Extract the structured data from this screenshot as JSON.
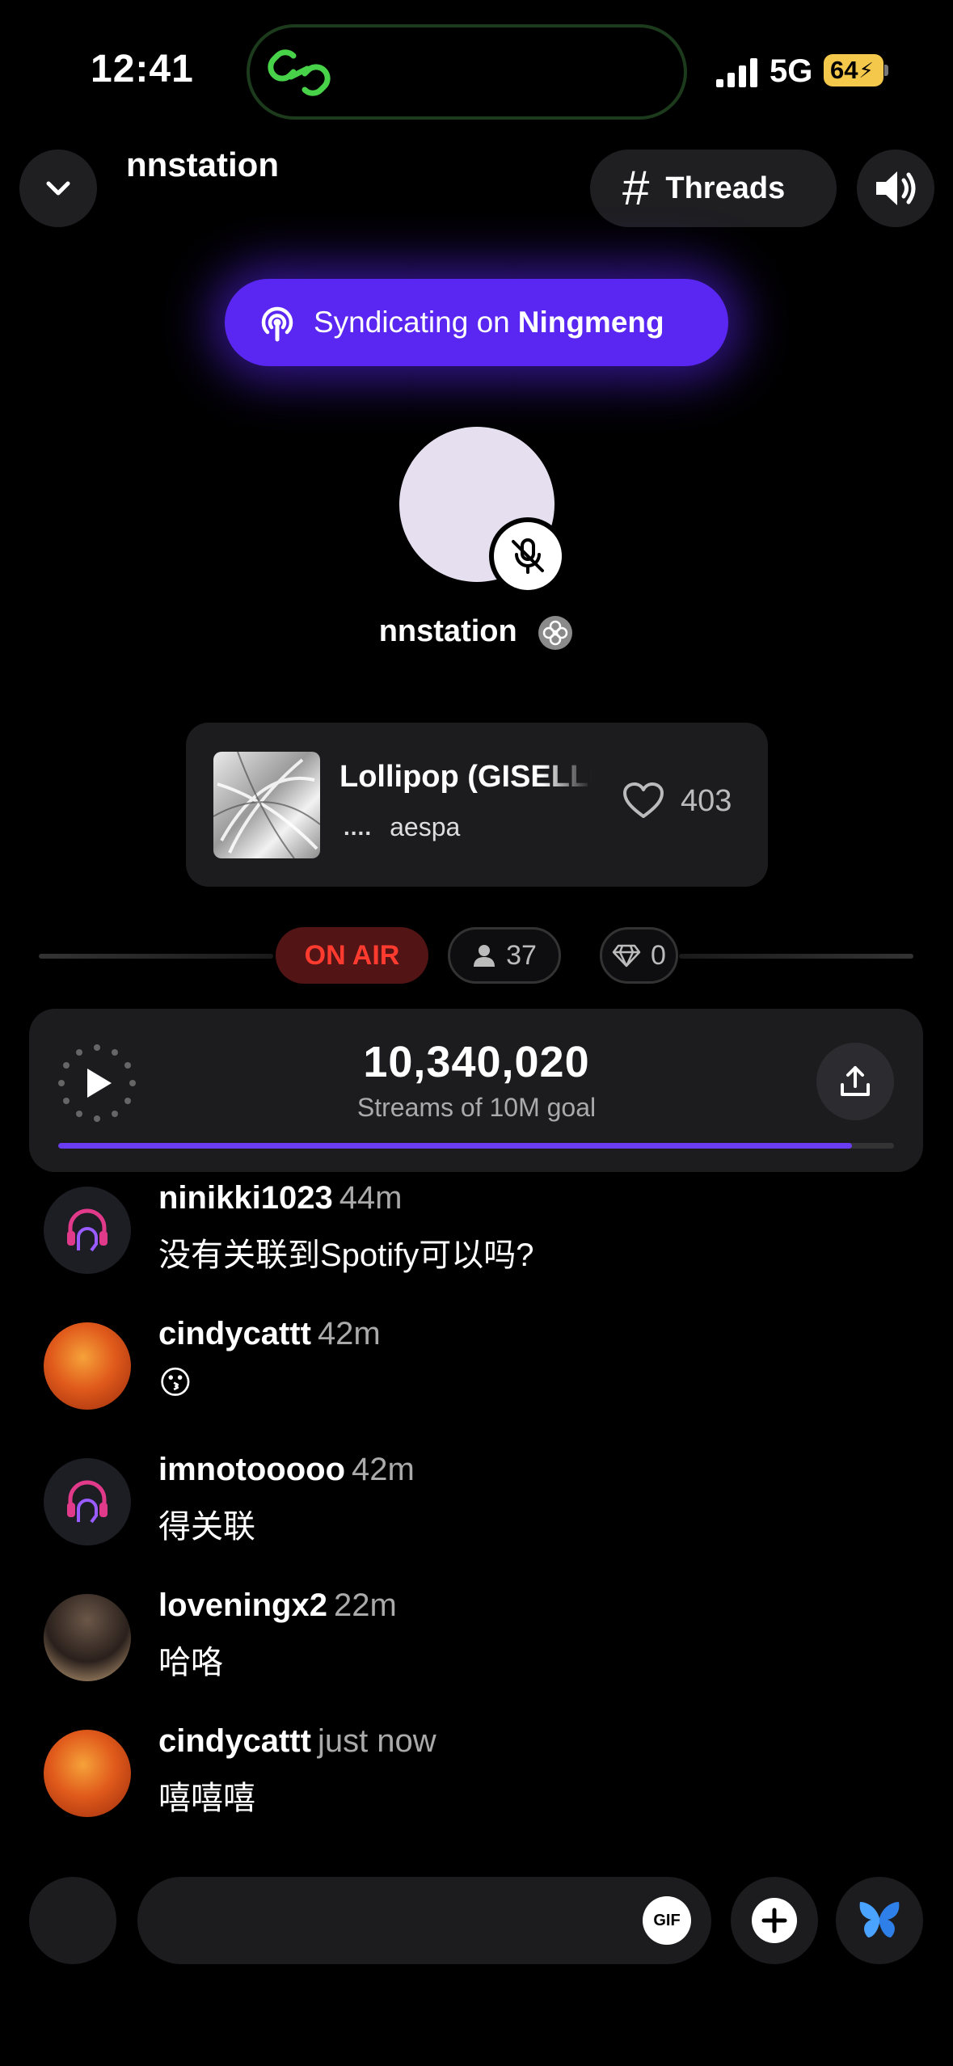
{
  "status_bar": {
    "time": "12:41",
    "network": "5G",
    "battery": "64"
  },
  "header": {
    "title": "nnstation",
    "threads_label": "Threads"
  },
  "syndication": {
    "prefix": "Syndicating on",
    "platform": "Ningmeng"
  },
  "host": {
    "name": "nnstation"
  },
  "now_playing": {
    "title": "Lollipop (GISELLE",
    "artist": "aespa",
    "likes": "403"
  },
  "live_status": {
    "on_air_label": "ON AIR",
    "listeners": "37",
    "gems": "0"
  },
  "stream_goal": {
    "count": "10,340,020",
    "caption": "Streams of 10M goal",
    "progress": 0.95
  },
  "comments": [
    {
      "user": "ninikki1023",
      "time": "44m",
      "text": "没有关联到Spotify可以吗?",
      "avatar": "headphone-avatar"
    },
    {
      "user": "cindycattt",
      "time": "42m",
      "text": "😗",
      "avatar": "bird-avatar"
    },
    {
      "user": "imnotooooo",
      "time": "42m",
      "text": "得关联",
      "avatar": "headphone-avatar"
    },
    {
      "user": "loveningx2",
      "time": "22m",
      "text": "哈咯",
      "avatar": "photo-avatar"
    },
    {
      "user": "cindycattt",
      "time": "just now",
      "text": "嘻嘻嘻",
      "avatar": "bird-avatar"
    }
  ],
  "composer": {
    "gif_label": "GIF"
  },
  "colors": {
    "accent": "#5a26f2",
    "on_air": "#ff3b30",
    "battery": "#f4c84a",
    "background": "#000000"
  }
}
